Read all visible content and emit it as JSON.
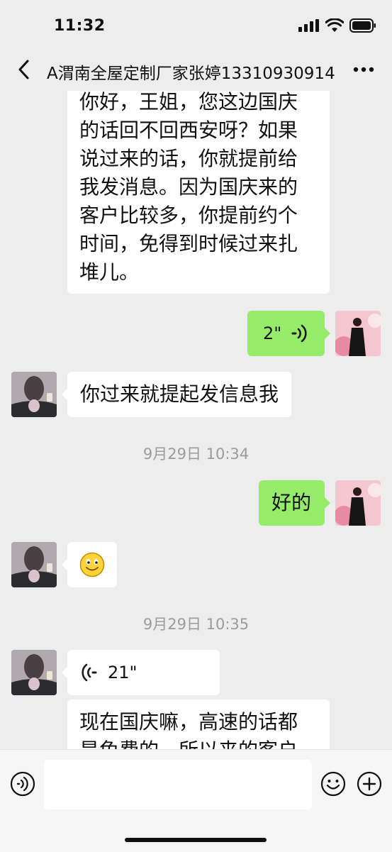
{
  "status_bar": {
    "time": "11:32"
  },
  "header": {
    "title": "A渭南全屋定制厂家张婷13310930914"
  },
  "messages": {
    "m1": {
      "lines": [
        "你好，王姐，您这边国庆",
        "的话回不回西安呀？如果",
        "说过来的话，你就提前给",
        "我发消息。因为国庆来的",
        "客户比较多，你提前约个",
        "时间，免得到时候过来扎",
        "堆儿。"
      ]
    },
    "m2": {
      "duration": "2\""
    },
    "m3": {
      "text": "你过来就提起发信息我"
    },
    "ts1": {
      "text": "9月29日 10:34"
    },
    "m4": {
      "text": "好的"
    },
    "m5": {
      "emoji": "🙂"
    },
    "ts2": {
      "text": "9月29日 10:35"
    },
    "m6": {
      "duration": "21\""
    },
    "m7": {
      "lines": [
        "现在国庆嘛，高速的话都",
        "是免费的，所以来的客户"
      ]
    }
  },
  "icons": {
    "back": "chevron-left-icon",
    "more": "more-dots-icon",
    "voice": "voice-mode-icon",
    "emoji": "emoji-icon",
    "plus": "plus-icon"
  },
  "colors": {
    "background": "#ededed",
    "incoming_bubble": "#ffffff",
    "outgoing_bubble": "#95ec69",
    "timestamp": "#9b9b9b"
  }
}
